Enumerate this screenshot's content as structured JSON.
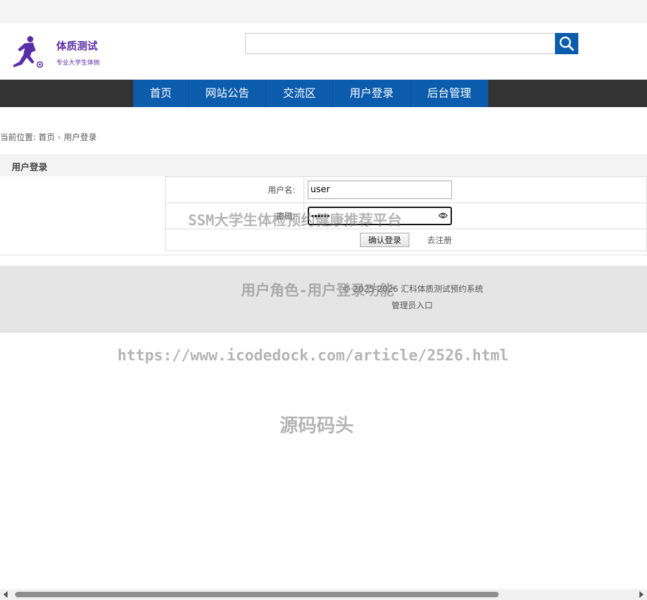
{
  "header": {
    "logo_title": "体质测试",
    "logo_subtitle": "专业大学生体侧",
    "search_value": "",
    "search_icon": "search-icon"
  },
  "nav": {
    "items": [
      {
        "label": "首页"
      },
      {
        "label": "网站公告"
      },
      {
        "label": "交流区"
      },
      {
        "label": "用户登录"
      },
      {
        "label": "后台管理"
      }
    ]
  },
  "breadcrumb": {
    "prefix": "当前位置:",
    "home": "首页",
    "current": "用户登录"
  },
  "section": {
    "title": "用户登录"
  },
  "form": {
    "username_label": "用户名:",
    "username_value": "user",
    "password_label": "密码:",
    "password_value": "123456",
    "confirm_label": "确认登录",
    "register_label": "去注册"
  },
  "footer": {
    "copyright": "© 2025-2026 汇科体质测试预约系统",
    "admin_link": "管理员入口"
  },
  "watermarks": {
    "line1": "SSM大学生体检预约健康推荐平台",
    "line2": "用户角色-用户登录功能",
    "line3": "https://www.icodedock.com/article/2526.html",
    "line4": "源码码头"
  },
  "colors": {
    "brand": "#0b5cad",
    "nav_bg": "#333333",
    "logo": "#5a2ea6"
  }
}
